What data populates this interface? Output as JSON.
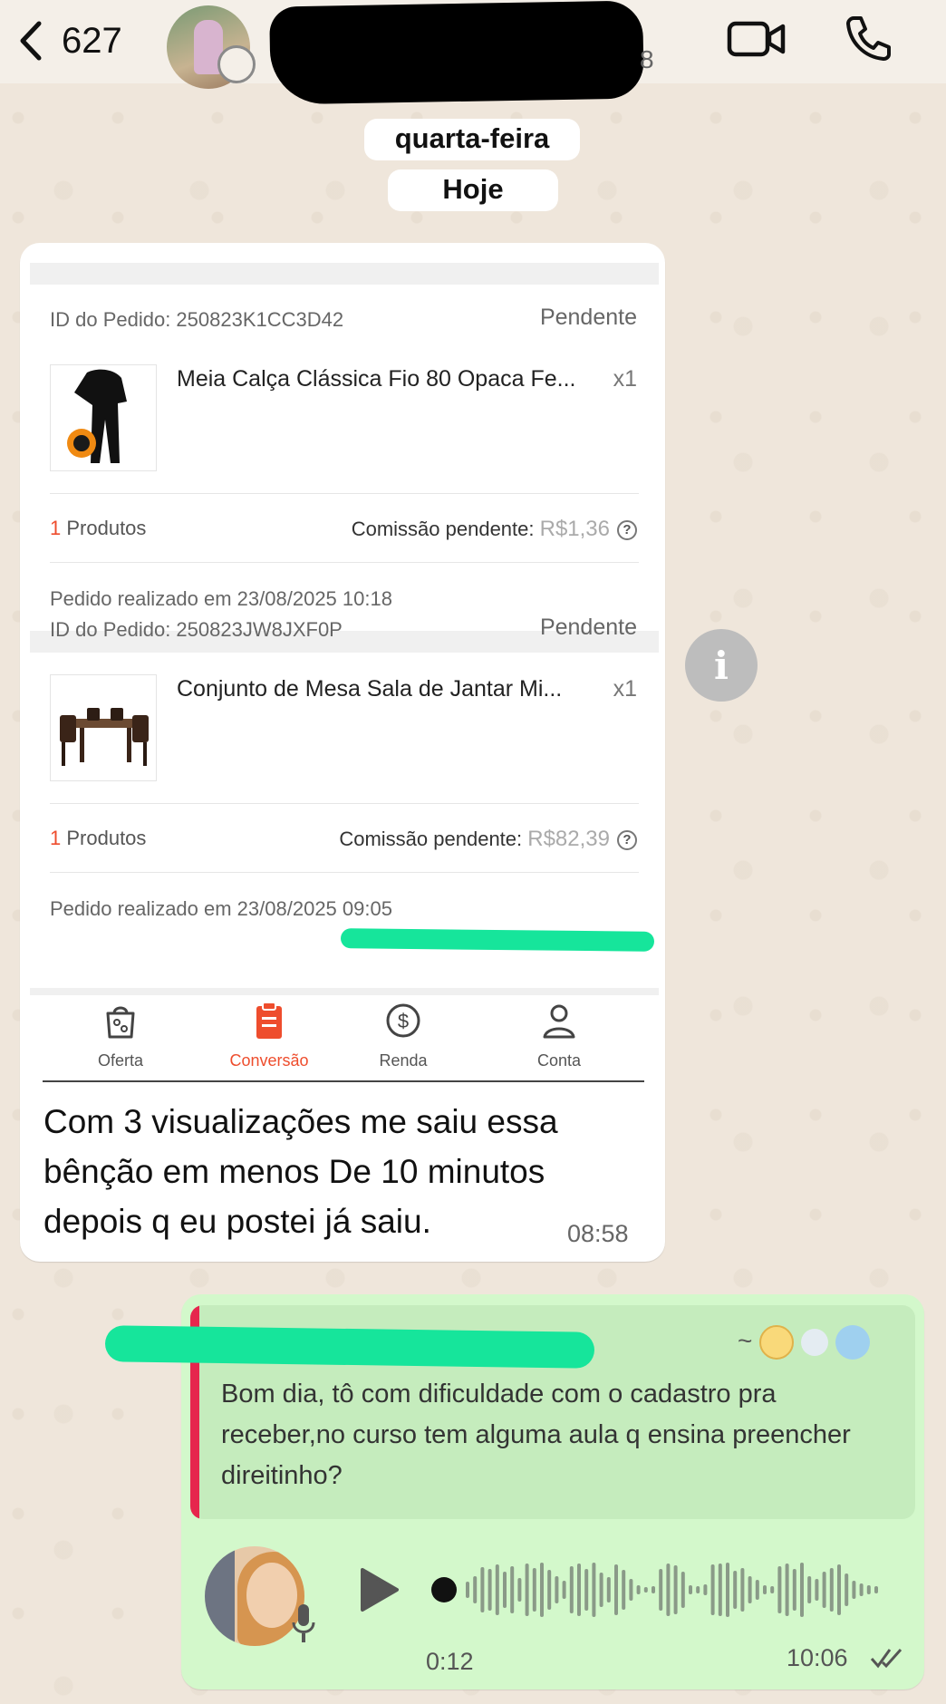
{
  "header": {
    "unread_count": "627",
    "contact_suffix": "8",
    "icons": {
      "back": "chevron-left-icon",
      "video": "video-camera-icon",
      "call": "phone-icon"
    }
  },
  "chat": {
    "date_chips": [
      "quarta-feira",
      "Hoje"
    ],
    "incoming": {
      "screenshot": {
        "orders": [
          {
            "id_label": "ID do Pedido: 250823K1CC3D42",
            "status": "Pendente",
            "product": "Meia Calça Clássica Fio 80 Opaca Fe...",
            "qty": "x1",
            "count_num": "1",
            "count_label": " Produtos",
            "commission_label": "Comissão pendente: ",
            "commission_value": "R$1,36",
            "date": "Pedido realizado em 23/08/2025 10:18"
          },
          {
            "id_label": "ID do Pedido: 250823JW8JXF0P",
            "status": "Pendente",
            "product": "Conjunto de Mesa Sala de Jantar Mi...",
            "qty": "x1",
            "count_num": "1",
            "count_label": " Produtos",
            "commission_label": "Comissão pendente: ",
            "commission_value": "R$82,39",
            "date": "Pedido realizado em 23/08/2025 09:05"
          }
        ],
        "help_glyph": "?",
        "nav": [
          {
            "label": "Oferta",
            "icon": "offer-bag-icon",
            "active": false
          },
          {
            "label": "Conversão",
            "icon": "clipboard-icon",
            "active": true
          },
          {
            "label": "Renda",
            "icon": "dollar-circle-icon",
            "active": false
          },
          {
            "label": "Conta",
            "icon": "person-icon",
            "active": false
          }
        ],
        "accent_color": "#ee4d2d",
        "highlight_color": "#16e59b"
      },
      "text": "Com 3 visualizações me saiu essa bênção em menos De 10 minutos depois q eu postei já saiu.",
      "time": "08:58"
    },
    "info_glyph": "i",
    "outgoing": {
      "quote": {
        "name_prefix": "~",
        "text": "Bom dia, tô com dificuldade com o cadastro pra receber,no curso tem alguma aula q ensina preencher  direitinho?"
      },
      "voice": {
        "duration": "0:12",
        "time": "10:06",
        "read_status": "read-double-check-icon"
      }
    }
  },
  "colors": {
    "wallpaper": "#efe6db",
    "incoming_bubble": "#ffffff",
    "outgoing_bubble": "#d3f8cb",
    "quote_bar": "#e6264d"
  }
}
